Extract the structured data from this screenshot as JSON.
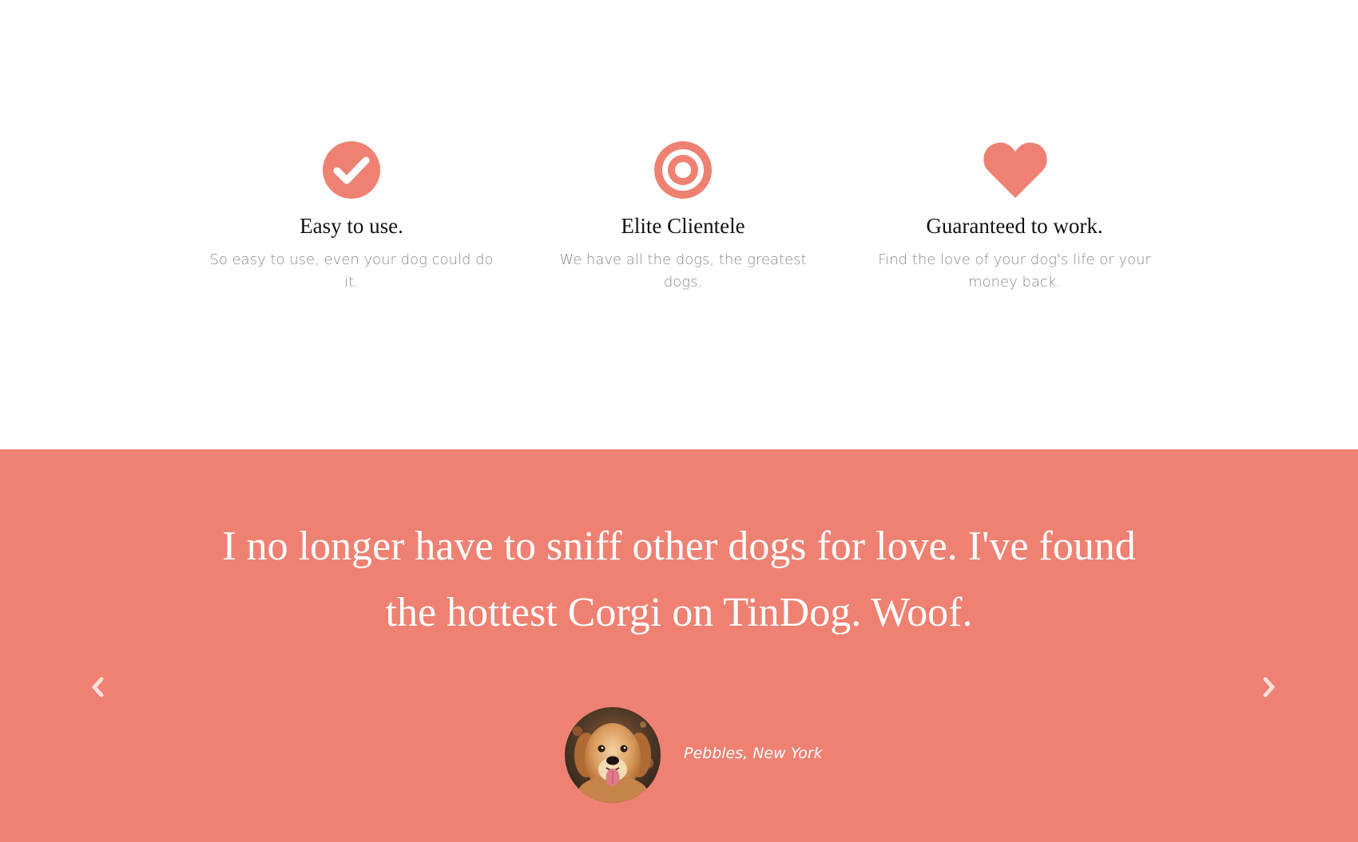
{
  "features": [
    {
      "icon": "check-circle-icon",
      "title": "Easy to use.",
      "text": "So easy to use, even your dog could do it."
    },
    {
      "icon": "bullseye-icon",
      "title": "Elite Clientele",
      "text": "We have all the dogs, the greatest dogs."
    },
    {
      "icon": "heart-icon",
      "title": "Guaranteed to work.",
      "text": "Find the love of your dog's life or your money back."
    }
  ],
  "testimonial": {
    "quote": "I no longer have to sniff other dogs for love. I've found the hottest Corgi on TinDog. Woof.",
    "author": "Pebbles, New York"
  },
  "colors": {
    "accent": "#ef8172",
    "text_dark": "#111111",
    "text_muted": "#8a8a8a",
    "white": "#ffffff"
  }
}
